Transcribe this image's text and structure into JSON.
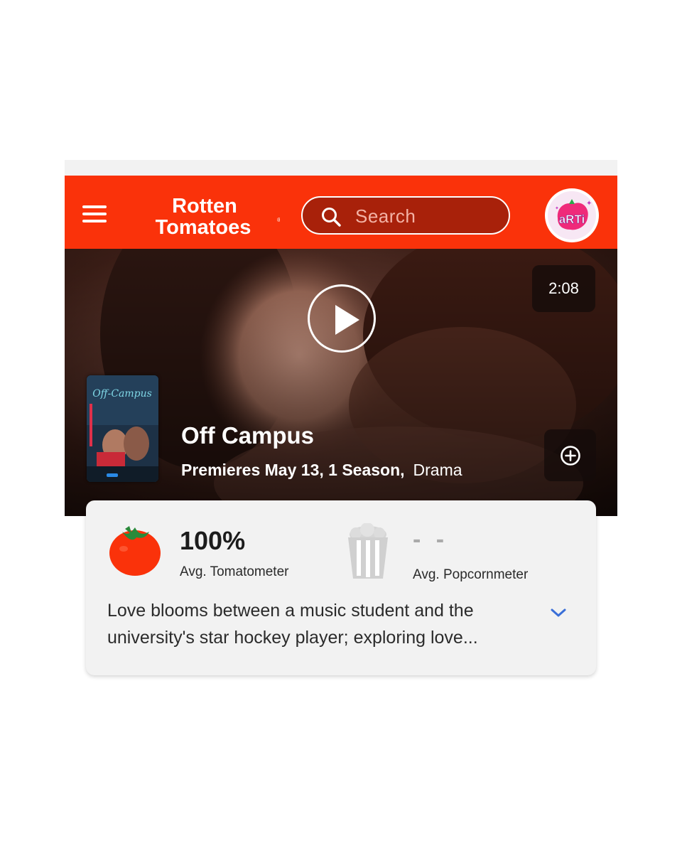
{
  "brand": {
    "line1": "Rotten",
    "line2": "Tomatoes"
  },
  "header": {
    "search_placeholder": "Search",
    "avatar_text": "aRTi"
  },
  "hero": {
    "duration": "2:08",
    "title": "Off Campus",
    "premiere": "Premieres May 13, 1 Season,",
    "genre": "Drama",
    "poster_title": "Off-Campus"
  },
  "scores": {
    "tomatometer_value": "100%",
    "tomatometer_label": "Avg. Tomatometer",
    "popcornmeter_value": "- -",
    "popcornmeter_label": "Avg. Popcornmeter"
  },
  "synopsis": "Love blooms between a music student and the university's star hockey player; exploring love...",
  "colors": {
    "brand_red": "#fa320a",
    "tomato": "#fa320a",
    "chevron_blue": "#3a6fd8"
  },
  "icons": [
    "hamburger-icon",
    "search-icon",
    "play-icon",
    "add-circle-icon",
    "tomato-icon",
    "popcorn-bucket-icon",
    "chevron-down-icon"
  ]
}
